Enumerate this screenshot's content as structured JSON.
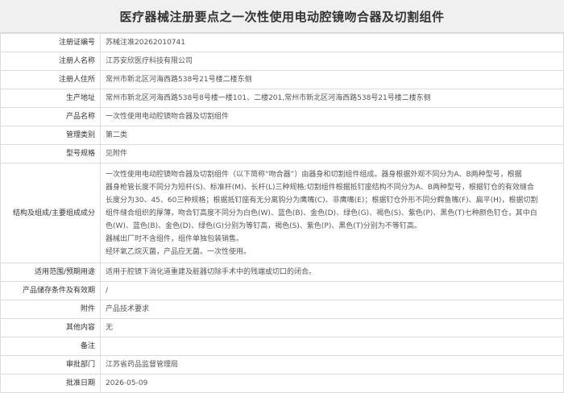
{
  "document": {
    "title": "医疗器械注册要点之一次性使用电动腔镜吻合器及切割组件"
  },
  "rows": [
    {
      "label": "注册证编号",
      "value": "苏械注准20262010741"
    },
    {
      "label": "注册人名称",
      "value": "江苏安欣医疗科技有限公司"
    },
    {
      "label": "注册人住所",
      "value": "常州市新北区河海西路538号21号楼二楼东侧"
    },
    {
      "label": "生产地址",
      "value": "常州市新北区河海西路538号8号楼一楼101、二楼201,常州市新北区河海西路538号21号楼二楼东侧"
    },
    {
      "label": "产品名称",
      "value": "一次性使用电动腔镜吻合器及切割组件"
    },
    {
      "label": "管理类别",
      "value": "第二类"
    },
    {
      "label": "型号规格",
      "value": "见附件"
    }
  ],
  "structure": {
    "label": "结构及组成/主要组成成分",
    "lines": [
      "一次性使用电动腔镜吻合器及切割组件（以下简称“吻合器”）由器身和切割组件组成。器身根据外观不同分为A、B两种型号，根据",
      "器身枪管长度不同分为短杆(S)、标准杆(M)、长杆(L)三种规格;切割组件根据抵钉座结构不同分为A、B两种型号，根据钉仓的有效缝合",
      "长度分为30、45、60三种规格；根据抵钉座有无分离钩分为鹰嘴(C)、非鹰嘴(E)；根据钉仓外形不同分鳄鱼嘴(F)、扁平(H)，根据切割",
      "组件缝合组织的厚薄，吻合钉高度不同分为白色(W)、蓝色(B)、金色(D)、绿色(G)、褐色(S)、紫色(P)、黑色(T)七种颜色钉仓，其中白",
      "色(W)、蓝色(B)、金色(D)、绿色(G)分别为等钉高，褐色(S)、紫色(P)、黑色(T)分别为不等钉高。",
      "器械出厂时不含组件，组件单独包装销售。",
      "经环氧乙烷灭菌，产品应无菌。一次性使用。"
    ]
  },
  "rows_after": [
    {
      "label": "适用范围/预期用途",
      "value": "适用于腔镜下消化道重建及脏器切除手术中的残端或切口的闭合。"
    },
    {
      "label": "产品储存条件及有效期",
      "value": "/"
    },
    {
      "label": "附件",
      "value": "产品技术要求"
    },
    {
      "label": "其他内容",
      "value": "无"
    },
    {
      "label": "备注",
      "value": ""
    },
    {
      "label": "审批部门",
      "value": "江苏省药品监督管理局"
    },
    {
      "label": "批准日期",
      "value": "2026-05-09"
    }
  ]
}
